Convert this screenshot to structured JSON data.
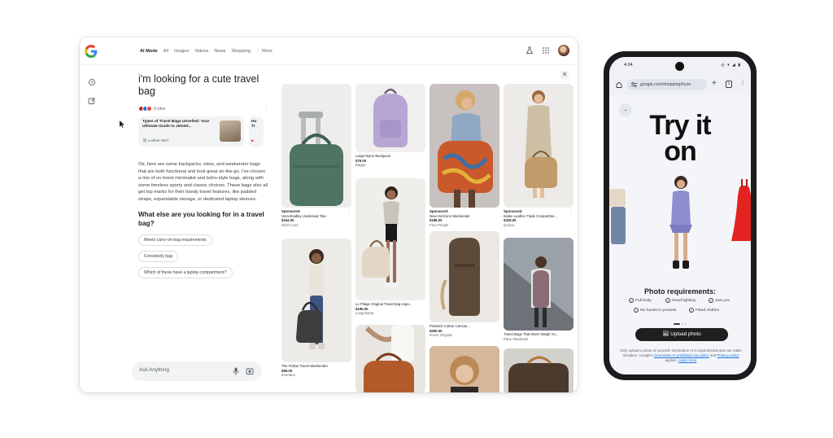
{
  "laptop": {
    "nav_tabs": [
      {
        "label": "AI Mode",
        "active": true
      },
      {
        "label": "All"
      },
      {
        "label": "Images"
      },
      {
        "label": "Videos"
      },
      {
        "label": "News"
      },
      {
        "label": "Shopping"
      },
      {
        "label": "⋮ More"
      }
    ],
    "chat": {
      "title": "i'm looking for a cute travel bag",
      "sources_label": "9 sites",
      "source_card": {
        "title": "Types of Travel Bags Unveiled: Your Ultimate Guide to Jetsett...",
        "source": "Leather NEO"
      },
      "source_card_2": {
        "title": "Ho Tr"
      },
      "answer": "Ok, here are some backpacks, totes, and weekender bags that are both functional and look great on-the-go. I've chosen a mix of on-trend minimalist and boho-style bags, along with some timeless sporty and classic choices. These bags also all get top marks for their handy travel features, like padded straps, expandable storage, or dedicated laptop sleeves.",
      "followup_question": "What else are you looking for in a travel bag?",
      "chips": [
        "Meets carry-on-bag requirements",
        "Crossbody bag",
        "Which of these have a laptop compartment?"
      ],
      "ask_placeholder": "Ask Anything"
    },
    "products": [
      {
        "col": 0,
        "sponsored": "Sponsored",
        "title": "Vera Bradley Underseat Tote",
        "price": "$164.00",
        "store": "Dick's.com"
      },
      {
        "col": 0,
        "title": "The Fellow Travel Weekender",
        "price": "$96.00",
        "store": "Everlane"
      },
      {
        "col": 1,
        "title": "Large Nylon Backpack",
        "price": "$79.00",
        "store": "Baggu"
      },
      {
        "col": 1,
        "title": "Le Pliage Original Travel bag expa...",
        "price": "$195.00",
        "store": "Longchamp"
      },
      {
        "col": 2,
        "sponsored": "Sponsored",
        "title": "New Horizons Weekender",
        "price": "$188.00",
        "store": "Free People"
      },
      {
        "col": 2,
        "title": "Pickwick Cotton Canvas...",
        "price": "$250.00",
        "store": "Rover Original"
      },
      {
        "col": 3,
        "sponsored": "Sponsored",
        "title": "Italian Leather Triple Compartme...",
        "price": "$329.00",
        "store": "Quince"
      },
      {
        "col": 3,
        "title": "Travel Bags That Won't Weigh Yo...",
        "price": "",
        "store": "Paris Stephanie"
      }
    ]
  },
  "phone": {
    "status_time": "4:04",
    "url": "google.com/shopping/tryon",
    "tab_count": "1",
    "hero_text": "Try it on",
    "photo_requirements_title": "Photo requirements:",
    "requirements": [
      "Full body",
      "Good lighting",
      "Just you",
      "No hands in pockets",
      "Fitted clothes"
    ],
    "upload_label": "Upload photo",
    "disclaimer_text": "Only upload a photo of yourself. Generative AI is experimental and can make mistakes. Google's",
    "disclaimer_link1": "Generative AI prohibited use policy",
    "disclaimer_and": "and",
    "disclaimer_link2": "Privacy policy",
    "disclaimer_end": "applies.",
    "disclaimer_link3": "Learn more"
  },
  "colors": {
    "google_blue": "#4285F4",
    "google_red": "#EA4335",
    "google_yellow": "#FBBC05",
    "google_green": "#34A853",
    "link_blue": "#1a73e8",
    "upload_button": "#1f1f1f"
  }
}
